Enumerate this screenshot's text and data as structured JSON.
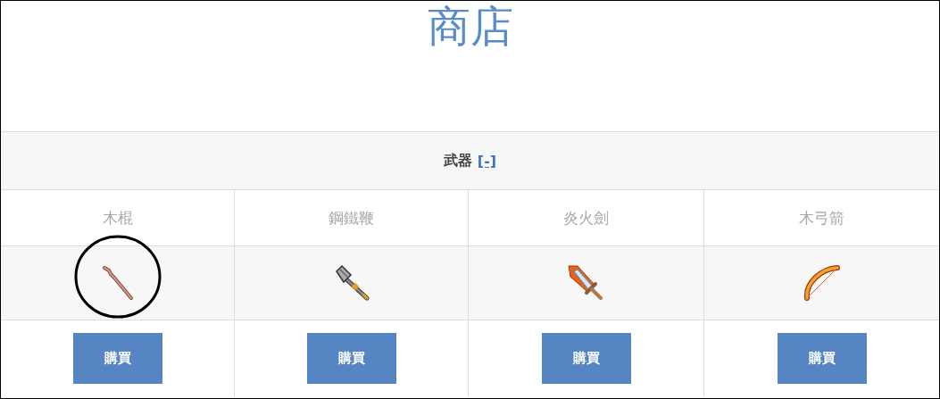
{
  "title": "商店",
  "category": {
    "name": "武器",
    "toggle": "[-]"
  },
  "items": [
    {
      "name": "木棍",
      "kind": "staff",
      "highlighted": true,
      "button": "購買"
    },
    {
      "name": "鋼鐵鞭",
      "kind": "mace",
      "highlighted": false,
      "button": "購買"
    },
    {
      "name": "炎火劍",
      "kind": "sword",
      "highlighted": false,
      "button": "購買"
    },
    {
      "name": "木弓箭",
      "kind": "bow",
      "highlighted": false,
      "button": "購買"
    }
  ]
}
